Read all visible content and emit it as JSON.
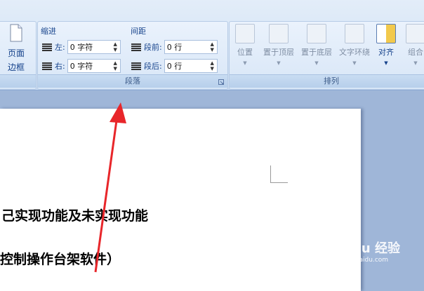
{
  "ribbon": {
    "page_border": {
      "line1": "页面",
      "line2": "边框"
    },
    "paragraph_group": {
      "label": "段落",
      "indent": {
        "title": "缩进",
        "left_label": "左:",
        "left_value": "0 字符",
        "right_label": "右:",
        "right_value": "0 字符"
      },
      "spacing": {
        "title": "间距",
        "before_label": "段前:",
        "before_value": "0 行",
        "after_label": "段后:",
        "after_value": "0 行"
      }
    },
    "arrange_group": {
      "label": "排列",
      "buttons": [
        "位置",
        "置于顶层",
        "置于底层",
        "文字环绕",
        "对齐",
        "组合"
      ]
    }
  },
  "document": {
    "line1": "己实现功能及未实现功能",
    "line2": "控制操作台架软件）"
  },
  "watermark": {
    "brand": "Baidu 经验",
    "url": "jingyan.baidu.com"
  },
  "colors": {
    "annotation_arrow": "#e8262a",
    "ribbon_text": "#15428b"
  }
}
